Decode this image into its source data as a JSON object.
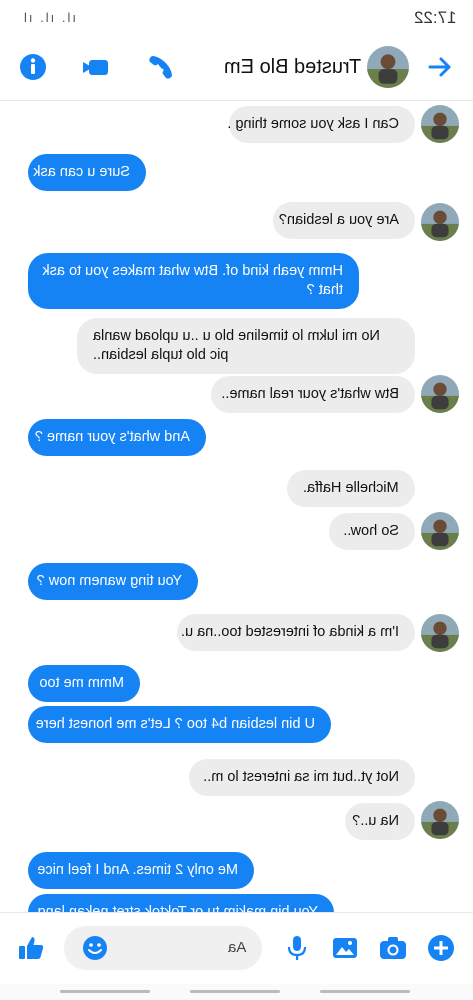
{
  "status": {
    "time": "17:22",
    "signal": "ıl. ıl. ıl"
  },
  "header": {
    "title": "Trusted Blo Em"
  },
  "messages": [
    {
      "dir": "in",
      "lines": [
        "Can I ask you some thing ."
      ]
    },
    {
      "dir": "out",
      "lines": [
        "Sure u can ask"
      ]
    },
    {
      "dir": "in",
      "lines": [
        "Are you a lesbian?"
      ]
    },
    {
      "dir": "out",
      "lines": [
        "Hmm yeah kind of. Btw what makes you to ask",
        "that ?"
      ]
    },
    {
      "dir": "in",
      "lines": [
        "No mi lukm lo timeline blo u ..u upload wanla",
        "pic blo tupla lesbian.."
      ]
    },
    {
      "dir": "in",
      "lines": [
        "Btw what's your real name.."
      ]
    },
    {
      "dir": "out",
      "lines": [
        "And what's your name ?"
      ]
    },
    {
      "dir": "in",
      "lines": [
        "Michelle Haffa."
      ]
    },
    {
      "dir": "in",
      "lines": [
        "So how.."
      ]
    },
    {
      "dir": "out",
      "lines": [
        "You ting wanem now ?"
      ]
    },
    {
      "dir": "in",
      "lines": [
        "I'm a kinda of interested too..na u."
      ]
    },
    {
      "dir": "out",
      "lines": [
        "Mmm me too"
      ]
    },
    {
      "dir": "out",
      "lines": [
        "U bin lesbian b4 too ? Let's me  honest here"
      ]
    },
    {
      "dir": "in",
      "lines": [
        "Not yt..but mi sa interest lo m.."
      ]
    },
    {
      "dir": "in",
      "lines": [
        "Na u..?"
      ]
    },
    {
      "dir": "out",
      "lines": [
        "Me only 2 times. And I feel nice"
      ]
    },
    {
      "dir": "out",
      "lines": [
        "You bin makim tu or Toktok stret nekan lang"
      ]
    }
  ],
  "composer": {
    "placeholder": "Aa"
  },
  "colors": {
    "accent": "#1683f5",
    "incoming": "#ececec"
  },
  "icons": [
    "info-icon",
    "video-call-icon",
    "phone-icon",
    "forward-arrow-icon",
    "thumbs-up-icon",
    "emoji-icon",
    "microphone-icon",
    "gallery-icon",
    "camera-icon",
    "plus-icon"
  ]
}
